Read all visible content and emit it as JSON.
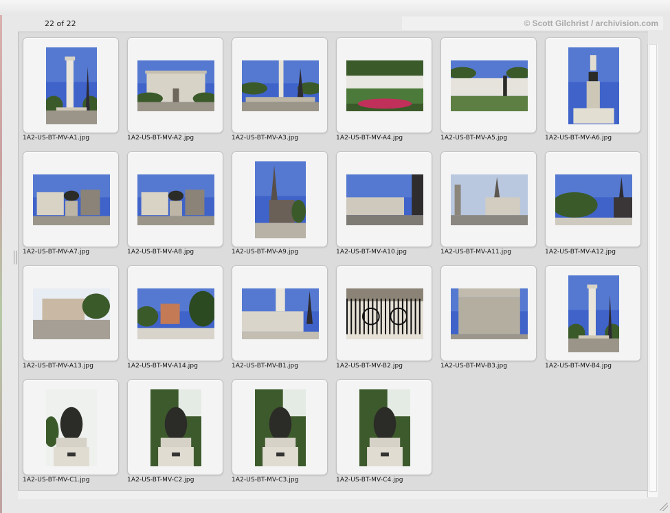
{
  "header": {
    "count_text": "22 of 22",
    "credit": "© Scott Gilchrist / archivision.com"
  },
  "colors": {
    "sky": "#3f63c9",
    "sky_light": "#7fa2e0",
    "stone": "#c9c3b6",
    "foliage": "#3b5a2a",
    "bronze": "#2b2b27"
  },
  "thumbnails": [
    {
      "file": "1A2-US-BT-MV-A1.jpg",
      "orientation": "portrait",
      "scene": "column-sky"
    },
    {
      "file": "1A2-US-BT-MV-A2.jpg",
      "orientation": "landscape",
      "scene": "building-sky"
    },
    {
      "file": "1A2-US-BT-MV-A3.jpg",
      "orientation": "landscape",
      "scene": "column-square"
    },
    {
      "file": "1A2-US-BT-MV-A4.jpg",
      "orientation": "landscape",
      "scene": "garden-flowers"
    },
    {
      "file": "1A2-US-BT-MV-A5.jpg",
      "orientation": "landscape",
      "scene": "balustrade-statue"
    },
    {
      "file": "1A2-US-BT-MV-A6.jpg",
      "orientation": "portrait",
      "scene": "monument-sky"
    },
    {
      "file": "1A2-US-BT-MV-A7.jpg",
      "orientation": "landscape",
      "scene": "equestrian"
    },
    {
      "file": "1A2-US-BT-MV-A8.jpg",
      "orientation": "landscape",
      "scene": "equestrian-city"
    },
    {
      "file": "1A2-US-BT-MV-A9.jpg",
      "orientation": "portrait",
      "scene": "church-spire"
    },
    {
      "file": "1A2-US-BT-MV-A10.jpg",
      "orientation": "landscape",
      "scene": "street-buildings"
    },
    {
      "file": "1A2-US-BT-MV-A11.jpg",
      "orientation": "landscape",
      "scene": "church-street"
    },
    {
      "file": "1A2-US-BT-MV-A12.jpg",
      "orientation": "landscape",
      "scene": "trees-spires"
    },
    {
      "file": "1A2-US-BT-MV-A13.jpg",
      "orientation": "landscape",
      "scene": "row-houses"
    },
    {
      "file": "1A2-US-BT-MV-A14.jpg",
      "orientation": "landscape",
      "scene": "park-buildings"
    },
    {
      "file": "1A2-US-BT-MV-B1.jpg",
      "orientation": "landscape",
      "scene": "column-base"
    },
    {
      "file": "1A2-US-BT-MV-B2.jpg",
      "orientation": "landscape",
      "scene": "iron-fence"
    },
    {
      "file": "1A2-US-BT-MV-B3.jpg",
      "orientation": "landscape",
      "scene": "pedestal"
    },
    {
      "file": "1A2-US-BT-MV-B4.jpg",
      "orientation": "portrait",
      "scene": "column-tall"
    },
    {
      "file": "1A2-US-BT-MV-C1.jpg",
      "orientation": "portrait",
      "scene": "sculpture-bright"
    },
    {
      "file": "1A2-US-BT-MV-C2.jpg",
      "orientation": "portrait",
      "scene": "sculpture-trees"
    },
    {
      "file": "1A2-US-BT-MV-C3.jpg",
      "orientation": "portrait",
      "scene": "sculpture-trees"
    },
    {
      "file": "1A2-US-BT-MV-C4.jpg",
      "orientation": "portrait",
      "scene": "sculpture-trees"
    }
  ]
}
